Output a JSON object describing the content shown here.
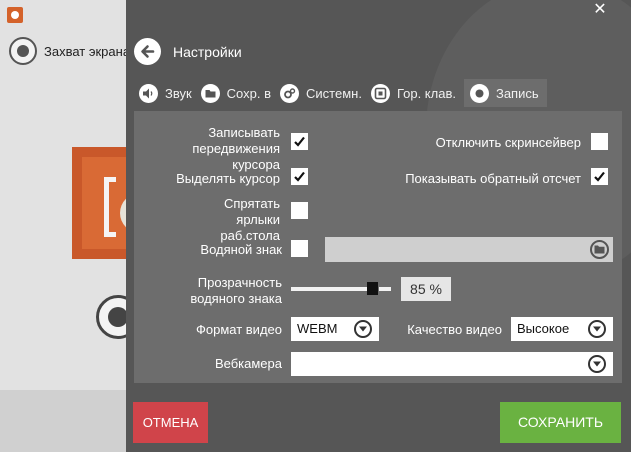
{
  "background_app": {
    "capture_label": "Захват экрана"
  },
  "header": {
    "title": "Настройки"
  },
  "tabs": [
    {
      "label": "Звук",
      "icon": "speaker-icon"
    },
    {
      "label": "Сохр. в",
      "icon": "folder-icon"
    },
    {
      "label": "Системн.",
      "icon": "gears-icon"
    },
    {
      "label": "Гор. клав.",
      "icon": "hotkey-icon"
    },
    {
      "label": "Запись",
      "icon": "record-icon",
      "active": true
    }
  ],
  "settings": {
    "record_cursor": {
      "label": "Записывать передвижения курсора",
      "checked": true
    },
    "highlight_cursor": {
      "label": "Выделять курсор",
      "checked": true
    },
    "hide_desktop_icons": {
      "label": "Спрятать ярлыки раб.стола",
      "checked": false
    },
    "disable_screensaver": {
      "label": "Отключить скринсейвер",
      "checked": false
    },
    "show_countdown": {
      "label": "Показывать обратный отсчет",
      "checked": true
    },
    "watermark": {
      "label": "Водяной знак",
      "checked": false,
      "path": ""
    },
    "watermark_opacity": {
      "label": "Прозрачность водяного знака",
      "value": 85,
      "display": "85 %"
    },
    "video_format": {
      "label": "Формат видео",
      "value": "WEBM"
    },
    "video_quality": {
      "label": "Качество видео",
      "value": "Высокое"
    },
    "webcam": {
      "label": "Вебкамера",
      "value": ""
    }
  },
  "footer": {
    "cancel_label": "ОТМЕНА",
    "save_label": "СОХРАНИТЬ"
  },
  "colors": {
    "overlay": "#565656",
    "panel": "#6d6d6d",
    "cancel": "#d0444a",
    "save": "#6ab241",
    "brand": "#d4622a"
  }
}
